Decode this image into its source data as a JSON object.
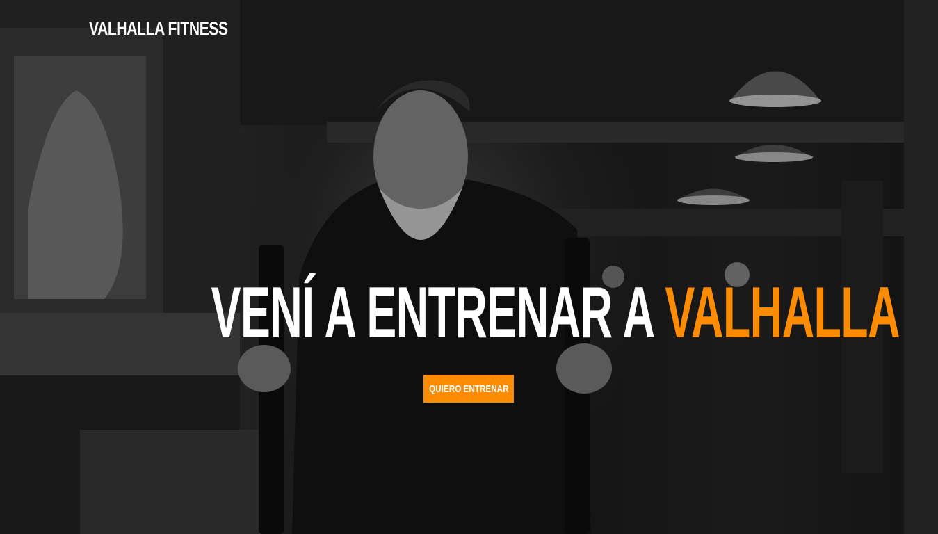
{
  "header": {
    "brand": "VALHALLA FITNESS"
  },
  "hero": {
    "headline_main": "VENÍ A ENTRENAR A ",
    "headline_accent": "VALHALLA",
    "cta_label": "QUIERO ENTRENAR",
    "background": "grayscale gym photo of bearded man pushing sled"
  },
  "colors": {
    "accent": "#ff8c00",
    "text": "#ffffff"
  }
}
